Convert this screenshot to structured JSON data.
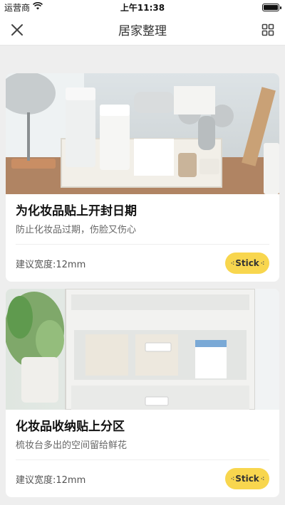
{
  "status_bar": {
    "carrier": "运营商",
    "time": "上午11:38"
  },
  "nav": {
    "title": "居家整理",
    "left_icon": "close-icon",
    "right_icon": "grid-icon"
  },
  "cards": [
    {
      "image": "cosmetics-organizer-photo",
      "title": "为化妆品贴上开封日期",
      "subtitle": "防止化妆品过期，伤脸又伤心",
      "width_text": "建议宽度:12mm",
      "button_label": "Stick"
    },
    {
      "image": "drawer-storage-photo",
      "title": "化妆品收纳贴上分区",
      "subtitle": "梳妆台多出的空间留给鲜花",
      "width_text": "建议宽度:12mm",
      "button_label": "Stick"
    }
  ],
  "colors": {
    "background": "#eeeeee",
    "card": "#ffffff",
    "button": "#f8d64e"
  }
}
